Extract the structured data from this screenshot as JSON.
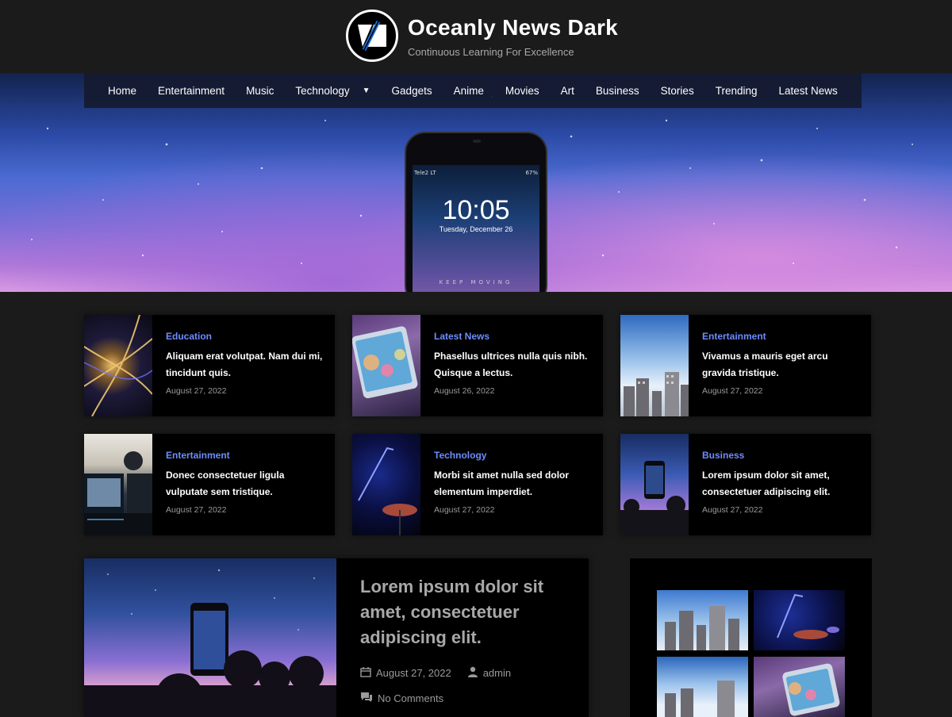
{
  "site": {
    "title": "Oceanly News Dark",
    "tagline": "Continuous Learning For Excellence"
  },
  "nav": {
    "items": [
      "Home",
      "Entertainment",
      "Music",
      "Technology",
      "Gadgets",
      "Anime",
      "Movies",
      "Art",
      "Business",
      "Stories",
      "Trending",
      "Latest News"
    ],
    "dropdown_icon": "chevron-down-icon"
  },
  "hero": {
    "phone_carrier": "Tele2 LT",
    "phone_battery": "67%",
    "phone_time": "10:05",
    "phone_date": "Tuesday, December 26",
    "phone_caption": "KEEP MOVING"
  },
  "cards": [
    {
      "category": "Education",
      "title": "Aliquam erat volutpat. Nam dui mi, tincidunt quis.",
      "date": "August 27, 2022"
    },
    {
      "category": "Latest News",
      "title": "Phasellus ultrices nulla quis nibh. Quisque a lectus.",
      "date": "August 26, 2022"
    },
    {
      "category": "Entertainment",
      "title": "Vivamus a mauris eget arcu gravida tristique.",
      "date": "August 27, 2022"
    },
    {
      "category": "Entertainment",
      "title": "Donec consectetuer ligula vulputate sem tristique.",
      "date": "August 27, 2022"
    },
    {
      "category": "Technology",
      "title": "Morbi sit amet nulla sed dolor elementum imperdiet.",
      "date": "August 27, 2022"
    },
    {
      "category": "Business",
      "title": "Lorem ipsum dolor sit amet, consectetuer adipiscing elit.",
      "date": "August 27, 2022"
    }
  ],
  "feature": {
    "title": "Lorem ipsum dolor sit amet, consectetuer adipiscing elit.",
    "date": "August 27, 2022",
    "author": "admin",
    "comments": "No Comments"
  },
  "colors": {
    "background": "#1b1b1b",
    "accent": "#6e8cff",
    "card": "#000000"
  }
}
